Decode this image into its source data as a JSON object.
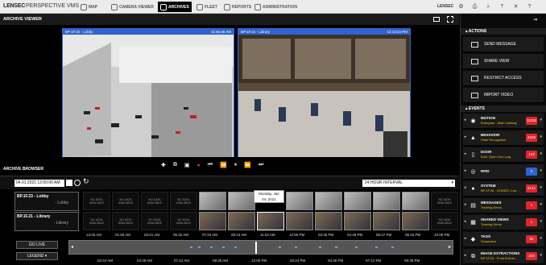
{
  "topbar": {
    "logo": "LENSEC",
    "product": "PERSPECTIVE VMS",
    "nav": [
      {
        "label": "MAP",
        "active": false
      },
      {
        "label": "CAMERA VIEWER",
        "active": false
      },
      {
        "label": "ARCHIVES",
        "active": true
      },
      {
        "label": "FLEET",
        "active": false
      },
      {
        "label": "REPORTS",
        "active": false
      },
      {
        "label": "ADMINISTRATION",
        "active": false
      }
    ],
    "user": "LENSEC",
    "icons": [
      "gear-icon",
      "print-icon",
      "search-icon",
      "pin-icon",
      "close-icon",
      "help-icon"
    ]
  },
  "viewer": {
    "title": "ARCHIVE VIEWER",
    "panes": [
      {
        "camera": "BP:1F.23 - Lobby",
        "time": "11:56:46 AM"
      },
      {
        "camera": "BP:1F.21 - Library",
        "time": "12:13:34 PM"
      }
    ]
  },
  "browser": {
    "title": "ARCHIVE BROWSER",
    "date": "04.01.2021 12:00:00 AM",
    "interval": "24 HOUR INTERVAL",
    "cameras": [
      {
        "name": "BP.1F.23 - Lobby",
        "sub": "- Lobby"
      },
      {
        "name": "BP.1F.21 - Library",
        "sub": "- Library"
      }
    ],
    "no_data": "NO DATA AVAILABLE",
    "tooltip": {
      "line1": "Monday, Jan",
      "line2": "04, 2021"
    },
    "thumb_times": [
      "12:00 AM",
      "01:50 AM",
      "03:41 AM",
      "05:32 AM",
      "07:23 AM",
      "09:13 AM",
      "11:04 AM",
      "12:55 PM",
      "02:46 PM",
      "04:36 PM",
      "06:27 PM",
      "08:18 PM",
      "10:09 PM"
    ],
    "go_live": "GO LIVE",
    "legend": "LEGEND",
    "timeline_ticks": [
      "02:24 AM",
      "04:48 AM",
      "07:12 AM",
      "09:36 AM",
      "12:00 PM",
      "02:24 PM",
      "04:48 PM",
      "07:12 PM",
      "09:36 PM"
    ]
  },
  "actions": {
    "title": "ACTIONS",
    "items": [
      "SEND MESSAGE",
      "SHARE VIEW",
      "RESTRICT ACCESS",
      "IMPORT VIDEO"
    ]
  },
  "events": {
    "title": "EVENTS",
    "items": [
      {
        "label": "MOTION",
        "sub": "Enterpark - Main Hallway",
        "count": "11253",
        "color": "#e0262b"
      },
      {
        "label": "BEHAVIOR",
        "sub": "Plate Recognition",
        "count": "2339",
        "color": "#e0262b"
      },
      {
        "label": "DOOR",
        "sub": "Door Open Too Long",
        "count": "133",
        "color": "#e0262b"
      },
      {
        "label": "RFID",
        "sub": "",
        "count": "0",
        "color": "#2f63d0"
      },
      {
        "label": "SYSTEM",
        "sub": "BP:1F.26 - LENSEC Con...",
        "count": "2141",
        "color": "#e0262b"
      },
      {
        "label": "MESSAGES",
        "sub": "Training Demo",
        "count": "1",
        "color": "#e0262b"
      },
      {
        "label": "SHARED VIEWS",
        "sub": "Training Demo",
        "count": "1",
        "color": "#e0262b"
      },
      {
        "label": "TAGS",
        "sub": "Suspicious",
        "count": "50",
        "color": "#e0262b"
      },
      {
        "label": "IMAGE EXTRACTIONS",
        "sub": "BP:1F.23 - Front Entran...",
        "count": "323",
        "color": "#e0262b"
      }
    ]
  }
}
